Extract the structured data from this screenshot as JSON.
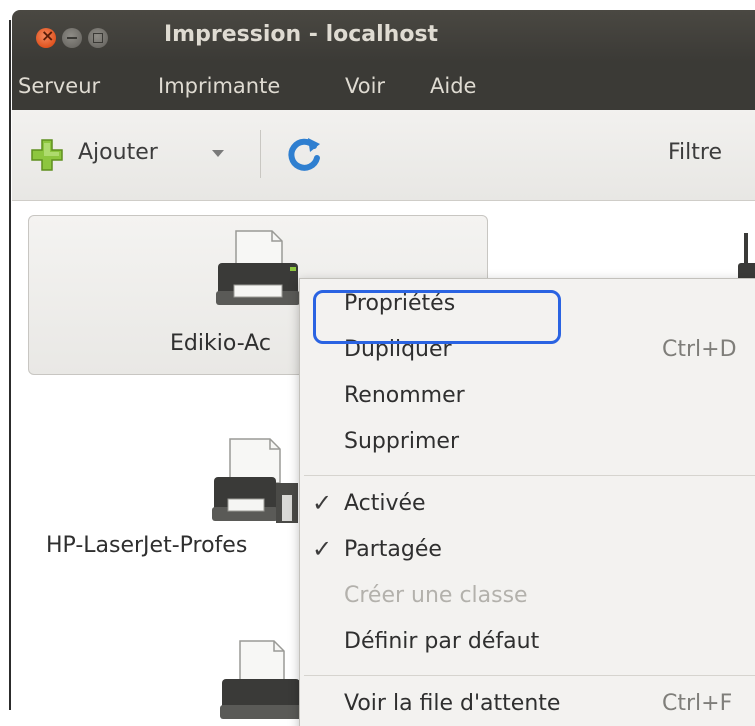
{
  "window": {
    "title": "Impression - localhost"
  },
  "menubar": {
    "items": [
      "Serveur",
      "Imprimante",
      "Voir",
      "Aide"
    ]
  },
  "toolbar": {
    "add_label": "Ajouter",
    "filter_label": "Filtre"
  },
  "printers": [
    {
      "name": "Edikio-Ac",
      "selected": true
    },
    {
      "name": "HP-LaserJet-Profes",
      "selected": false
    },
    {
      "name": "",
      "selected": false
    }
  ],
  "context_menu": {
    "items": [
      {
        "label": "Propriétés",
        "shortcut": "",
        "checked": false,
        "enabled": true
      },
      {
        "label": "Dupliquer",
        "shortcut": "Ctrl+D",
        "checked": false,
        "enabled": true
      },
      {
        "label": "Renommer",
        "shortcut": "",
        "checked": false,
        "enabled": true
      },
      {
        "label": "Supprimer",
        "shortcut": "",
        "checked": false,
        "enabled": true
      },
      {
        "label": "Activée",
        "shortcut": "",
        "checked": true,
        "enabled": true
      },
      {
        "label": "Partagée",
        "shortcut": "",
        "checked": true,
        "enabled": true
      },
      {
        "label": "Créer une classe",
        "shortcut": "",
        "checked": false,
        "enabled": false
      },
      {
        "label": "Définir par défaut",
        "shortcut": "",
        "checked": false,
        "enabled": true
      },
      {
        "label": "Voir la file d'attente",
        "shortcut": "Ctrl+F",
        "checked": false,
        "enabled": true
      }
    ],
    "check_glyph": "✓"
  },
  "colors": {
    "titlebar": "#3b3a36",
    "highlight_outline": "#2a63e2",
    "close_button": "#e0531f"
  },
  "icons": [
    "close-icon",
    "minimize-icon",
    "maximize-icon",
    "add-icon",
    "dropdown-arrow-icon",
    "refresh-icon",
    "printer-icon",
    "checkmark-icon"
  ]
}
